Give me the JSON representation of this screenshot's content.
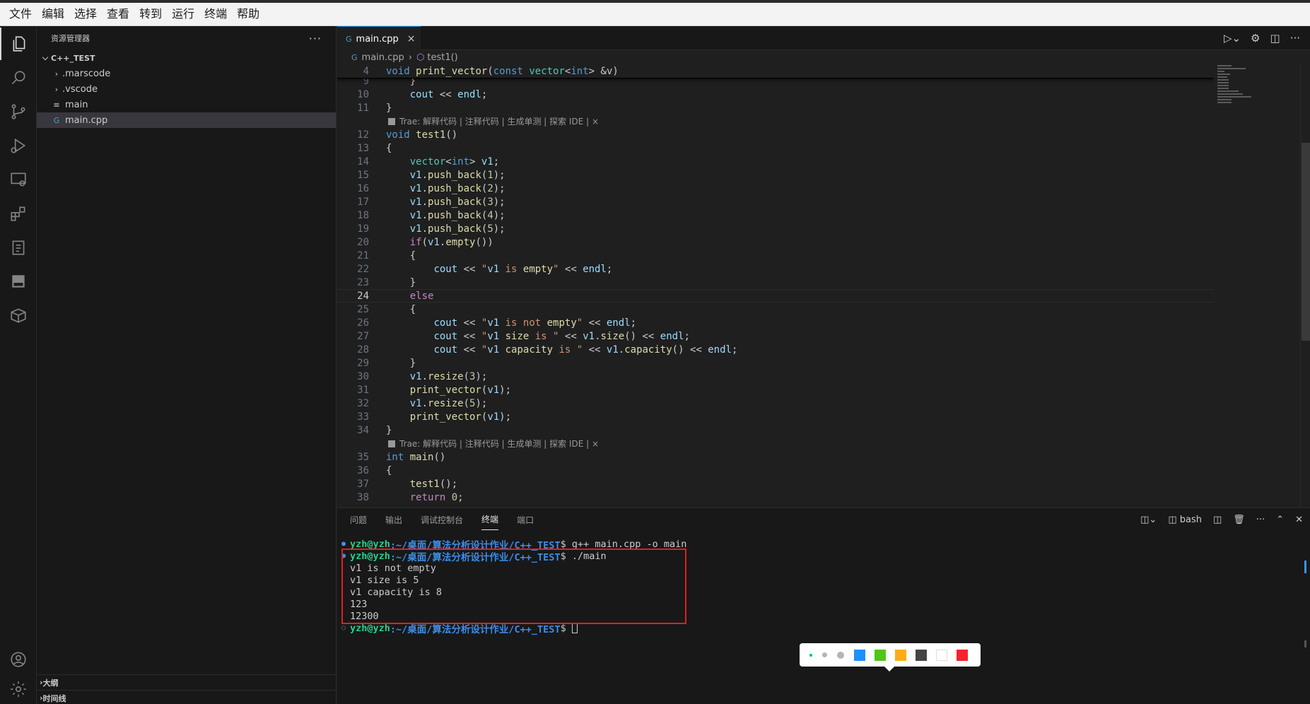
{
  "menubar": {
    "items": [
      "文件",
      "编辑",
      "选择",
      "查看",
      "转到",
      "运行",
      "终端",
      "帮助"
    ]
  },
  "activity_bar": {
    "icons": [
      "explorer-icon",
      "search-icon",
      "source-control-icon",
      "run-debug-icon",
      "remote-explorer-icon",
      "extensions-icon",
      "testing-icon",
      "panel-icon",
      "package-icon",
      "account-icon",
      "manage-gear-icon"
    ]
  },
  "sidebar": {
    "title": "资源管理器",
    "more": "···",
    "root": "C++_TEST",
    "items": [
      {
        "label": ".marscode",
        "kind": "folder"
      },
      {
        "label": ".vscode",
        "kind": "folder"
      },
      {
        "label": "main",
        "kind": "file",
        "icon": "≡"
      },
      {
        "label": "main.cpp",
        "kind": "cpp",
        "icon": "G",
        "selected": true
      }
    ],
    "outline": "大纲",
    "timeline": "时间线"
  },
  "editor": {
    "tab": {
      "label": "main.cpp",
      "icon": "G",
      "close": "×"
    },
    "breadcrumb": {
      "file": "main.cpp",
      "symbol": "test1()"
    },
    "codelens": "Trae: 解释代码 | 注释代码 | 生成单测 | 探索 IDE | ×",
    "lines": {
      "l4": "void print_vector(const vector<int> &v)",
      "l9": "    }",
      "l10": "    cout << endl;",
      "l11": "}",
      "l12": "void test1()",
      "l13": "{",
      "l14": "    vector<int> v1;",
      "l15": "    v1.push_back(1);",
      "l16": "    v1.push_back(2);",
      "l17": "    v1.push_back(3);",
      "l18": "    v1.push_back(4);",
      "l19": "    v1.push_back(5);",
      "l20": "    if(v1.empty())",
      "l21": "    {",
      "l22": "        cout << \"v1 is empty\" << endl;",
      "l23": "    }",
      "l24": "    else",
      "l25": "    {",
      "l26": "        cout << \"v1 is not empty\" << endl;",
      "l27": "        cout << \"v1 size is \" << v1.size() << endl;",
      "l28": "        cout << \"v1 capacity is \" << v1.capacity() << endl;",
      "l29": "    }",
      "l30": "    v1.resize(3);",
      "l31": "    print_vector(v1);",
      "l32": "    v1.resize(5);",
      "l33": "    print_vector(v1);",
      "l34": "}",
      "l35": "int main()",
      "l36": "{",
      "l37": "    test1();",
      "l38": "    return 0;"
    }
  },
  "panel": {
    "tabs": [
      "问题",
      "输出",
      "调试控制台",
      "终端",
      "端口"
    ],
    "active_tab": "终端",
    "shell": "bash",
    "terminal": {
      "user": "yzh@yzh",
      "path": ":~/桌面/算法分析设计作业/C++_TEST",
      "prompt_end": "$ ",
      "cmd1": "g++ main.cpp -o main",
      "cmd2": "./main",
      "output": [
        "v1 is not empty",
        "v1 size is 5",
        "v1 capacity is 8",
        "123",
        "12300"
      ]
    }
  },
  "colorbar": {
    "swatches": [
      "#1e90ff",
      "#52c41a",
      "#faad14",
      "#444444",
      "#ffffff",
      "#f5222d"
    ]
  }
}
